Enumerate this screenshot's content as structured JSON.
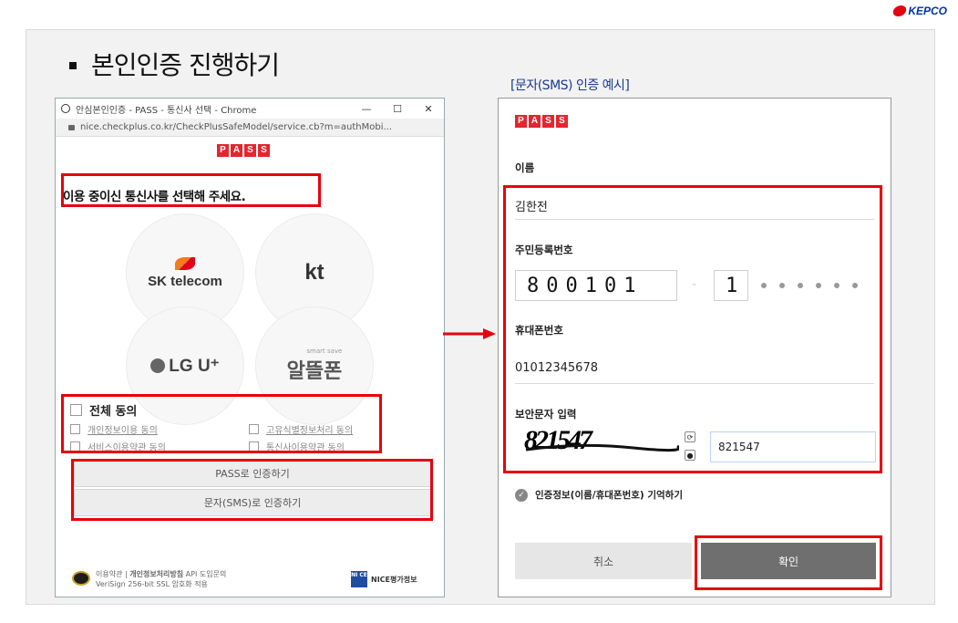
{
  "brand": {
    "logo_text": "KEPCO"
  },
  "slide": {
    "title": "본인인증 진행하기",
    "sms_caption": "[문자(SMS) 인증 예시]"
  },
  "browser": {
    "window_title": "안심본인인증 - PASS - 통신사 선택 - Chrome",
    "window_buttons": [
      "—",
      "☐",
      "✕"
    ],
    "url": "nice.checkplus.co.kr/CheckPlusSafeModel/service.cb?m=authMobi...",
    "pass_logo": [
      "P",
      "A",
      "S",
      "S"
    ],
    "prompt": "이용 중이신 통신사를 선택해 주세요.",
    "carriers": [
      {
        "id": "skt",
        "label": "SK telecom"
      },
      {
        "id": "kt",
        "label": "kt"
      },
      {
        "id": "lgu",
        "label": "LG U⁺"
      },
      {
        "id": "mvno",
        "label": "알뜰폰",
        "sublabel": "smart save"
      }
    ],
    "consent_all": "전체 동의",
    "consents": [
      "개인정보이용 동의",
      "고유식별정보처리 동의",
      "서비스이용약관 동의",
      "통신사이용약관 동의"
    ],
    "pass_auth_label": "PASS로 인증하기",
    "sms_auth_label": "문자(SMS)로 인증하기",
    "footer": {
      "terms": "이용약관",
      "privacy": "개인정보처리방침",
      "api": "API 도입문의",
      "ssl": "VeriSign 256-bit SSL 암호화 적용",
      "nice": "NICE평가정보",
      "nice_mark": "NI CE"
    }
  },
  "sms": {
    "pass_logo": [
      "P",
      "A",
      "S",
      "S"
    ],
    "name_label": "이름",
    "name_value": "김한전",
    "rrn_label": "주민등록번호",
    "rrn_front": "800101",
    "rrn_separator": "-",
    "rrn_back_first": "1",
    "phone_label": "휴대폰번호",
    "phone_value": "01012345678",
    "captcha_label": "보안문자 입력",
    "captcha_image_text": "821547",
    "captcha_input": "821547",
    "remember_label": "인증정보(이름/휴대폰번호) 기억하기",
    "cancel_label": "취소",
    "confirm_label": "확인"
  },
  "colors": {
    "highlight": "#e8000b",
    "pass_red": "#e3262f",
    "caption_blue": "#1a3a8f"
  }
}
